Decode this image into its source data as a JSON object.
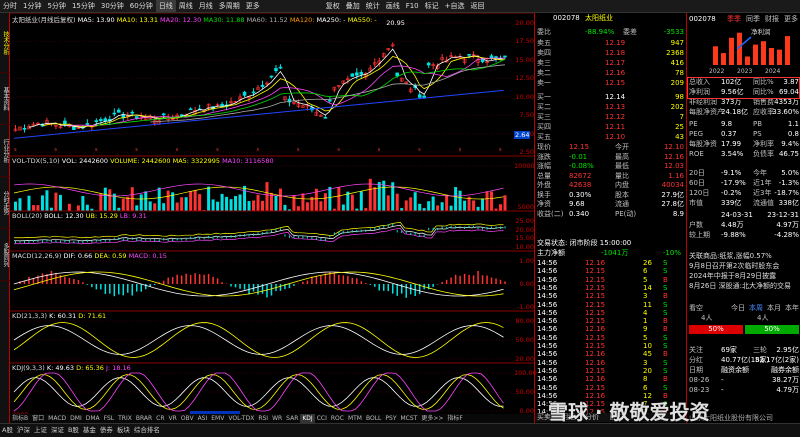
{
  "topbar": {
    "items": [
      "分时",
      "1分钟",
      "5分钟",
      "15分钟",
      "30分钟",
      "60分钟",
      "日线",
      "周线",
      "月线",
      "多周期",
      "更多"
    ],
    "active": 6,
    "tools": [
      "复权",
      "叠加",
      "统计",
      "画线",
      "F10",
      "标记",
      "+自选",
      "返回"
    ]
  },
  "leftstrip": [
    "技术分析",
    "基本资料",
    "行业分析",
    "分时走势",
    "多股同列"
  ],
  "kline": {
    "title": "太阳纸业(月线后复权)",
    "ma": [
      {
        "label": "MA5: 13.90",
        "color": "#ffffff"
      },
      {
        "label": "MA10: 13.31",
        "color": "#ffff00"
      },
      {
        "label": "MA20: 12.30",
        "color": "#ff44ff"
      },
      {
        "label": "MA30: 11.88",
        "color": "#00e000"
      },
      {
        "label": "MA60: 11.52",
        "color": "#aaaaaa"
      },
      {
        "label": "MA120:",
        "color": "#ff9900"
      },
      {
        "label": "MA250: -",
        "color": "#ffffff"
      },
      {
        "label": "MA550: -",
        "color": "#ffff00"
      }
    ],
    "yticks": [
      "20.00",
      "17.50",
      "15.00",
      "12.50",
      "10.00",
      "7.50",
      "5.00",
      "2.50"
    ],
    "high_label": "20.95",
    "low_label": "2.64"
  },
  "vol": {
    "title": "VOL-TDX(5,10)",
    "items": [
      {
        "label": "VOL: 2442600",
        "color": "#ffffff"
      },
      {
        "label": "VOLUME: 2442600",
        "color": "#ffff00"
      },
      {
        "label": "MA5: 3322995",
        "color": "#ffff00"
      },
      {
        "label": "MA10: 3116580",
        "color": "#ff44ff"
      }
    ],
    "yticks": [
      "10000",
      "5000"
    ]
  },
  "boll": {
    "title": "BOLL(20)",
    "items": [
      {
        "label": "BOLL: 12.30",
        "color": "#ffffff"
      },
      {
        "label": "UB: 15.29",
        "color": "#ffff00"
      },
      {
        "label": "LB: 9.31",
        "color": "#ff44ff"
      }
    ],
    "yticks": [
      "25.00",
      "20.00",
      "15.00",
      "10.00"
    ]
  },
  "macd": {
    "title": "MACD(12,26,9)",
    "items": [
      {
        "label": "DIF: 0.66",
        "color": "#ffffff"
      },
      {
        "label": "DEA: 0.59",
        "color": "#ffff00"
      },
      {
        "label": "MACD: 0.15",
        "color": "#ff44ff"
      }
    ],
    "yticks": [
      "1.00",
      "0.00",
      "-1.00"
    ]
  },
  "kd": {
    "title": "KD(21,3,3)",
    "items": [
      {
        "label": "K: 60.31",
        "color": "#ffffff"
      },
      {
        "label": "D: 71.61",
        "color": "#ffff00"
      }
    ],
    "yticks": [
      "80.00",
      "50.00",
      "20.00"
    ]
  },
  "kdj": {
    "title": "KDJ(9,3,3)",
    "items": [
      {
        "label": "K: 49.63",
        "color": "#ffffff"
      },
      {
        "label": "D: 65.36",
        "color": "#ffff00"
      },
      {
        "label": "J: 18.16",
        "color": "#ff44ff"
      }
    ],
    "yticks": [
      "100.00",
      "50.00",
      "0.00"
    ]
  },
  "date_label": "2015/01/30/五",
  "date_start": "2009",
  "indtabs": [
    "指标B",
    "窗口",
    "MACD",
    "DMI",
    "DMA",
    "FSL",
    "TRIX",
    "BRAR",
    "CR",
    "VR",
    "OBV",
    "ASI",
    "EMV",
    "VOL-TDX",
    "RSI",
    "WR",
    "SAR",
    "KDJ",
    "CCI",
    "ROC",
    "MTM",
    "BOLL",
    "PSY",
    "MCST",
    "更多>>",
    "指标F"
  ],
  "quote": {
    "code": "002078",
    "name": "太阳纸业",
    "weibi": {
      "label": "委比",
      "pct": "-88.94%",
      "cha_label": "委差",
      "cha": "-3533"
    },
    "sell": [
      {
        "l": "卖五",
        "p": "12.19",
        "v": "947"
      },
      {
        "l": "卖四",
        "p": "12.18",
        "v": "2368"
      },
      {
        "l": "卖三",
        "p": "12.17",
        "v": "416"
      },
      {
        "l": "卖二",
        "p": "12.16",
        "v": "78"
      },
      {
        "l": "卖一",
        "p": "12.15",
        "v": "209"
      }
    ],
    "buy": [
      {
        "l": "买一",
        "p": "12.14",
        "v": "98"
      },
      {
        "l": "买二",
        "p": "12.13",
        "v": "202"
      },
      {
        "l": "买三",
        "p": "12.12",
        "v": "7"
      },
      {
        "l": "买四",
        "p": "12.11",
        "v": "25"
      },
      {
        "l": "买五",
        "p": "12.10",
        "v": "43"
      }
    ],
    "stats": [
      [
        "现价",
        "12.15",
        "今开",
        "12.10"
      ],
      [
        "涨跌",
        "-0.01",
        "最高",
        "12.16"
      ],
      [
        "涨幅",
        "-0.08%",
        "最低",
        "12.03"
      ],
      [
        "总量",
        "82672",
        "量比",
        "1.16"
      ],
      [
        "外盘",
        "42638",
        "内盘",
        "40034"
      ],
      [
        "换手",
        "0.30%",
        "股本",
        "27.9亿"
      ],
      [
        "净资",
        "9.68",
        "流通",
        "27.8亿"
      ],
      [
        "收益(二)",
        "0.340",
        "PE(动)",
        "8.9"
      ]
    ],
    "trade_status": "交易状态: 闭市阶段 15:00:00",
    "zhuli": "主力净额",
    "zhuli_val": "-1041万",
    "zhuli_pct": "-10%",
    "ticks": [
      [
        "14:56",
        "12.16",
        "26",
        "S"
      ],
      [
        "14:56",
        "12.15",
        "6",
        "S"
      ],
      [
        "14:56",
        "12.15",
        "5",
        "B"
      ],
      [
        "14:56",
        "12.15",
        "14",
        "S"
      ],
      [
        "14:56",
        "12.15",
        "3",
        "B"
      ],
      [
        "14:56",
        "12.15",
        "11",
        "S"
      ],
      [
        "14:56",
        "12.15",
        "4",
        "S"
      ],
      [
        "14:56",
        "12.15",
        "1",
        "B"
      ],
      [
        "14:56",
        "12.16",
        "9",
        "B"
      ],
      [
        "14:56",
        "12.15",
        "5",
        "S"
      ],
      [
        "14:56",
        "12.15",
        "10",
        "S"
      ],
      [
        "14:56",
        "12.16",
        "45",
        "B"
      ],
      [
        "14:56",
        "12.16",
        "3",
        "S"
      ],
      [
        "14:56",
        "12.15",
        "20",
        "S"
      ],
      [
        "14:56",
        "12.16",
        "8",
        "B"
      ],
      [
        "14:56",
        "12.15",
        "6",
        "S"
      ],
      [
        "14:56",
        "12.16",
        "12",
        "B"
      ],
      [
        "14:56",
        "12.15",
        "7",
        "S"
      ],
      [
        "14:56",
        "12.15",
        "2",
        "B"
      ]
    ],
    "bottom_tabs": [
      "买卖",
      "明细",
      "分价",
      "日内"
    ]
  },
  "right": {
    "code": "002078",
    "tabs": [
      "季季",
      "同季",
      "财报",
      "更多"
    ],
    "chart_label": "净利润",
    "years": [
      "2022",
      "2023",
      "2024"
    ],
    "bars": [
      0.55,
      0.35,
      0.8,
      0.95,
      0.25,
      0.6,
      0.7,
      0.5,
      0.45,
      0.85
    ],
    "fin": [
      [
        "总收入",
        "102亿",
        "同比%",
        "3.87"
      ],
      [
        "净利润",
        "9.56亿",
        "同比%",
        "69.04"
      ],
      [
        "非经利润",
        "373万",
        "销售费",
        "4353万"
      ],
      [
        "每股净资产",
        "24.18亿",
        "应收率",
        "33.60%"
      ]
    ],
    "val": [
      [
        "PE",
        "9.8",
        "PB",
        "1.1"
      ],
      [
        "PEG",
        "0.37",
        "PS",
        "0.8"
      ],
      [
        "每股净资",
        "17.99",
        "净利率",
        "9.4%"
      ],
      [
        "ROE",
        "3.54%",
        "负债率",
        "46.75"
      ]
    ],
    "perf": [
      [
        "20日",
        "-9.1%",
        "今年",
        "5.0%"
      ],
      [
        "60日",
        "-17.9%",
        "近1年",
        "-1.3%"
      ],
      [
        "120日",
        "-0.2%",
        "近3年",
        "-18.7%"
      ],
      [
        "市值",
        "339亿",
        "流通值",
        "338亿"
      ]
    ],
    "dates": [
      [
        "",
        "24-03-31",
        "",
        "23-12-31"
      ],
      [
        "户数",
        "4.48万",
        "",
        "4.97万"
      ],
      [
        "较上期",
        "-9.88%",
        "",
        "-4.28%"
      ]
    ],
    "news": [
      "关联商品:纸浆,涨幅0.57%",
      "9月8日召开第2次临时股东会",
      "2024年中报于8月29日披露",
      "8月26日 深股通:北大净额的交易"
    ],
    "vote": {
      "label": "看空",
      "mid": "今日",
      "hot": "本周",
      "month": "本月",
      "year": "本年",
      "left": "4人",
      "right": "4人",
      "lpct": "50%",
      "rpct": "50%"
    },
    "bottom": [
      [
        "关注",
        "69家",
        "三轮",
        "2.95亿"
      ],
      [
        "分红",
        "40.77亿(18家)",
        "",
        "52.17亿(2家)"
      ],
      [
        "日期",
        "融资余额",
        "",
        "融券余额"
      ],
      [
        "08-26",
        "-",
        "",
        "38.27万"
      ],
      [
        "08-23",
        "-",
        "",
        "4.79万"
      ]
    ],
    "company": "山东太阳纸业股份有限公司"
  },
  "bottombar": [
    "A股",
    "沪深",
    "上证",
    "深证",
    "B股",
    "基金",
    "债券",
    "板块",
    "综合排名"
  ],
  "watermark": "雪球 · 敬敬爱投资"
}
